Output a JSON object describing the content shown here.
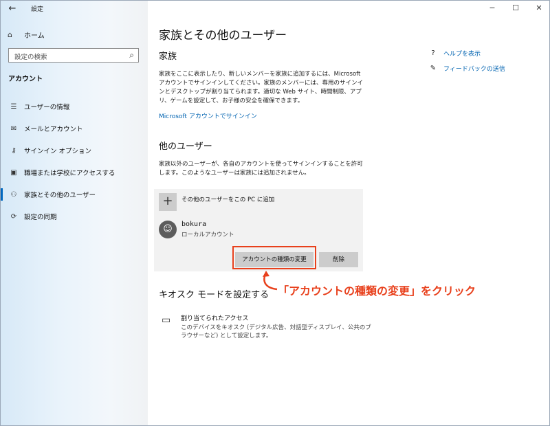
{
  "window": {
    "title": "設定",
    "back_icon": "back-arrow-icon",
    "controls": [
      "−",
      "☐",
      "✕"
    ]
  },
  "sidebar": {
    "home_label": "ホーム",
    "search_placeholder": "設定の検索",
    "section_title": "アカウント",
    "items": [
      {
        "label": "ユーザーの情報",
        "icon": "person-card-icon",
        "active": false
      },
      {
        "label": "メールとアカウント",
        "icon": "mail-icon",
        "active": false
      },
      {
        "label": "サインイン オプション",
        "icon": "key-icon",
        "active": false
      },
      {
        "label": "職場または学校にアクセスする",
        "icon": "briefcase-icon",
        "active": false
      },
      {
        "label": "家族とその他のユーザー",
        "icon": "person-icon",
        "active": true
      },
      {
        "label": "設定の同期",
        "icon": "sync-icon",
        "active": false
      }
    ]
  },
  "main": {
    "page_title": "家族とその他のユーザー",
    "family": {
      "heading": "家族",
      "description": "家族をここに表示したり、新しいメンバーを家族に追加するには、Microsoft アカウントでサインインしてください。家族のメンバーには、専用のサインインとデスクトップが割り当てられます。適切な Web サイト、時間制限、アプリ、ゲームを設定して、お子様の安全を確保できます。",
      "link": "Microsoft アカウントでサインイン"
    },
    "others": {
      "heading": "他のユーザー",
      "description": "家族以外のユーザーが、各自のアカウントを使ってサインインすることを許可します。このようなユーザーは家族には追加されません。",
      "add_label": "その他のユーザーをこの PC に追加",
      "user_name": "bokura",
      "user_type": "ローカルアカウント",
      "change_button": "アカウントの種類の変更",
      "delete_button": "削除"
    },
    "kiosk": {
      "heading": "キオスク モードを設定する",
      "title": "割り当てられたアクセス",
      "description": "このデバイスをキオスク (デジタル広告、対話型ディスプレイ、公共のブラウザーなど) として設定します。"
    },
    "help": {
      "help_label": "ヘルプを表示",
      "feedback_label": "フィードバックの送信"
    }
  },
  "annotation": {
    "text": "「アカウントの種類の変更」をクリック",
    "color": "#e8401c"
  },
  "colors": {
    "accent": "#0067c0",
    "link": "#0063b1",
    "button": "#cccccc",
    "panel": "#f2f2f2"
  }
}
